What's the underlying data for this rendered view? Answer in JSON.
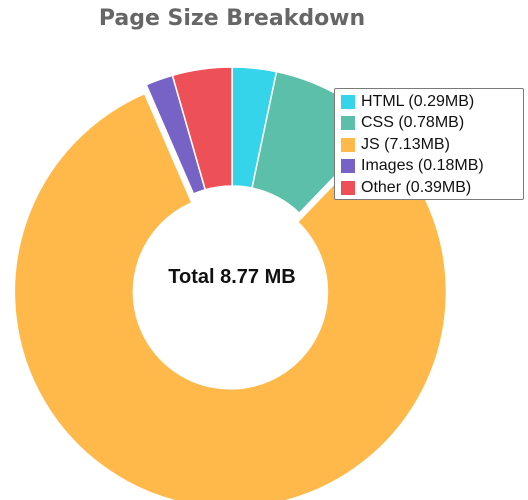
{
  "chart_data": {
    "type": "pie",
    "title": "Page Size Breakdown",
    "center_label": "Total 8.77 MB",
    "legend_placement": "top-right",
    "categories": [
      "HTML (0.29MB)",
      "CSS (0.78MB)",
      "JS (7.13MB)",
      "Images (0.18MB)",
      "Other (0.39MB)"
    ],
    "values": [
      0.29,
      0.78,
      7.13,
      0.18,
      0.39
    ],
    "colors": [
      "#36d4ea",
      "#5bbfaa",
      "#ffb94a",
      "#7762c6",
      "#ee5058"
    ],
    "legend": [
      {
        "label": "HTML (0.29MB)",
        "color": "#36d4ea"
      },
      {
        "label": "CSS (0.78MB)",
        "color": "#5bbfaa"
      },
      {
        "label": "JS (7.13MB)",
        "color": "#ffb94a"
      },
      {
        "label": "Images (0.18MB)",
        "color": "#7762c6"
      },
      {
        "label": "Other (0.39MB)",
        "color": "#ee5058"
      }
    ],
    "exploded_slice": "JS (7.13MB)"
  }
}
